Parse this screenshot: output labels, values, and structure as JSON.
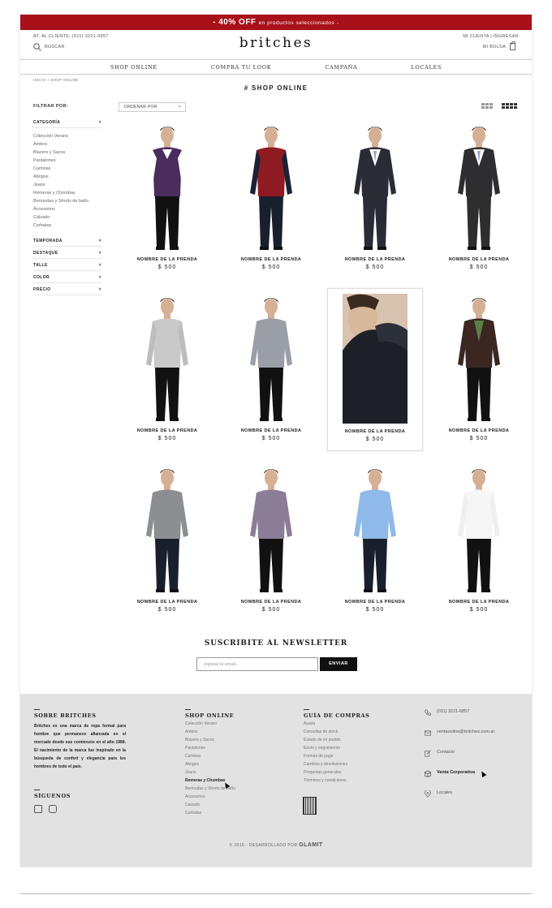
{
  "promo": {
    "highlight": "- 40% OFF",
    "rest": "en productos seleccionados",
    "end": "-"
  },
  "header": {
    "phone": "AT. AL CLIENTE: (011) 3221-6857",
    "search": "BUSCAR",
    "logo": "britches",
    "account": "MI CUENTA",
    "sep": "|",
    "login": "INGRESAR",
    "bag": "MI BOLSA"
  },
  "nav": [
    "SHOP ONLINE",
    "COMPRÁ TU LOOK",
    "CAMPAÑA",
    "LOCALES"
  ],
  "breadcrumb": "INICIO > SHOP ONLINE",
  "page_title": "# SHOP ONLINE",
  "sidebar": {
    "filter_label": "FILTRAR POR:",
    "category_label": "CATEGORÍA",
    "categories": [
      "Colección Verano",
      "Ambos",
      "Blazers y Sacos",
      "Pantalones",
      "Camisas",
      "Abrigos",
      "Jeans",
      "Remeras y Chombas",
      "Bermudas y Shorts de baño",
      "Accesorios",
      "Calzado",
      "Corbatas"
    ],
    "sections": [
      "TEMPORADA",
      "DESTAQUE",
      "TALLE",
      "COLOR",
      "PRECIO"
    ]
  },
  "order_label": "ORDENAR POR",
  "products": [
    {
      "name": "NOMBRE DE LA PRENDA",
      "price": "$ 500"
    },
    {
      "name": "NOMBRE DE LA PRENDA",
      "price": "$ 500"
    },
    {
      "name": "NOMBRE DE LA PRENDA",
      "price": "$ 500"
    },
    {
      "name": "NOMBRE DE LA PRENDA",
      "price": "$ 500"
    },
    {
      "name": "NOMBRE DE LA PRENDA",
      "price": "$ 500"
    },
    {
      "name": "NOMBRE DE LA PRENDA",
      "price": "$ 500"
    },
    {
      "name": "NOMBRE DE LA PRENDA",
      "price": "$ 500"
    },
    {
      "name": "NOMBRE DE LA PRENDA",
      "price": "$ 500"
    },
    {
      "name": "NOMBRE DE LA PRENDA",
      "price": "$ 500"
    },
    {
      "name": "NOMBRE DE LA PRENDA",
      "price": "$ 500"
    },
    {
      "name": "NOMBRE DE LA PRENDA",
      "price": "$ 500"
    },
    {
      "name": "NOMBRE DE LA PRENDA",
      "price": "$ 500"
    }
  ],
  "newsletter": {
    "title": "SUSCRIBITE AL NEWSLETTER",
    "placeholder": "Ingresá tu email...",
    "button": "ENVIAR"
  },
  "footer": {
    "about_title": "SOBRE BRITCHES",
    "about_text": "Britches es una marca de ropa formal para hombre que permanece afianzada en el mercado desde sus comienzos en el año 1988. El nacimiento de la marca fue inspirado en la búsqueda de confort y elegancia para los hombres de todo el país.",
    "follow_title": "SÍGUENOS",
    "shop_title": "SHOP ONLINE",
    "shop_items": [
      "Colección Verano",
      "Ambos",
      "Blazers y Sacos",
      "Pantalones",
      "Camisas",
      "Abrigos",
      "Jeans",
      "Remeras y Chombas",
      "Bermudas y Shorts de baño",
      "Accesorios",
      "Calzado",
      "Corbatas"
    ],
    "guide_title": "GUÍA DE COMPRAS",
    "guide_items": [
      "Ayuda",
      "Consultas de stock",
      "Estado de mi pedido",
      "Envío y seguimiento",
      "Formas de pago",
      "Cambios y devoluciones",
      "Preguntas generales",
      "Términos y condiciones"
    ],
    "contact": [
      "(011) 3221-6857",
      "ventaonline@britches.com.ar",
      "Contacto",
      "Venta Corporativa",
      "Locales"
    ],
    "copyright": "© 2016 - DESARROLLADO POR",
    "dev": "GLAMIT"
  }
}
